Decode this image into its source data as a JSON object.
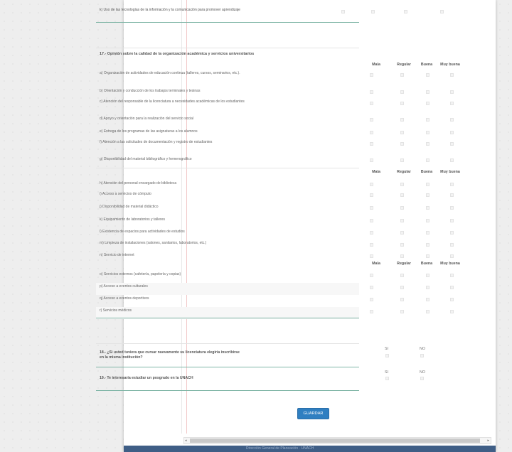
{
  "section16_item": "k) Uso de las tecnologías de la información y la comunicación para promover aprendizaje",
  "section17": {
    "title": "17.- Opinión sobre la calidad de la organización académica y servicios universitarios",
    "columns": [
      "Mala",
      "Regular",
      "Buena",
      "Muy buena"
    ],
    "items_a": [
      "a) Organización de actividades de educación continua (talleres, cursos, seminarios, etc.).",
      "b) Orientación y conducción de los trabajos terminales y tesinas",
      "c) Atención del responsable de la licenciatura a necesidades académicas de los estudiantes",
      "d) Apoyo y orientación para la realización del servicio social",
      "e) Entrega de los programas de las asignaturas a los alumnos",
      "f) Atención a las solicitudes de documentación y registro de estudiantes",
      "g) Disponibilidad del material bibliográfico y hemerográfico"
    ],
    "items_b": [
      "h) Atención del personal encargado de biblioteca",
      "i) Acceso a servicios de cómputo",
      "j) Disponibilidad de material didáctico",
      "k) Equipamiento de laboratorios y talleres",
      "l) Existencia de espacios para actividades de estudios",
      "m) Limpieza de instalaciones (salones, sanitarios, laboratorios, etc.)",
      "n) Servicio de internet"
    ],
    "items_c": [
      "o) Servicios externos (cafetería, papelería y copias)",
      "p) Acceso a eventos culturales",
      "q) Acceso a eventos deportivos",
      "r) Servicios médicos"
    ]
  },
  "q18": {
    "text": "18.- ¿Si usted tuviera que cursar nuevamente su licenciatura elegiría inscribirse en la misma institución?",
    "yes": "SI",
    "no": "NO"
  },
  "q19": {
    "text": "19.- Te interesaría estudiar un posgrado en la UNACH",
    "yes": "SI",
    "no": "NO"
  },
  "save_label": "GUARDAR",
  "scroll": {
    "left_arrow": "◂",
    "right_arrow": "▸"
  },
  "footer_text": "Dirección General de Planeación · UNACH"
}
